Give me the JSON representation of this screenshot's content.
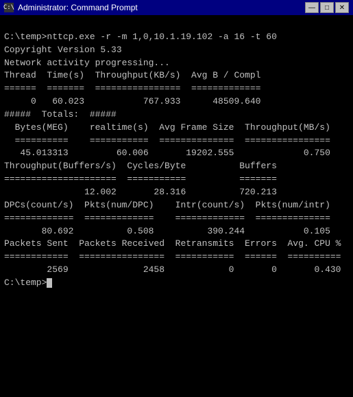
{
  "titleBar": {
    "icon": "C:\\",
    "title": "Administrator: Command Prompt",
    "minimize": "—",
    "maximize": "□",
    "close": "✕"
  },
  "terminal": {
    "lines": [
      "C:\\temp>nttcp.exe -r -m 1,0,10.1.19.102 -a 16 -t 60",
      "Copyright Version 5.33",
      "Network activity progressing...",
      "",
      "",
      "Thread  Time(s)  Throughput(KB/s)  Avg B / Compl",
      "======  =======  ================  =============",
      "     0   60.023           767.933      48509.640",
      "",
      "",
      "#####  Totals:  #####",
      "",
      "",
      "  Bytes(MEG)    realtime(s)  Avg Frame Size  Throughput(MB/s)",
      "  ==========    ===========  ==============  ================",
      "   45.013313         60.006       19202.555             0.750",
      "",
      "",
      "Throughput(Buffers/s)  Cycles/Byte          Buffers",
      "=====================  ===========          =======",
      "               12.002       28.316          720.213",
      "",
      "",
      "DPCs(count/s)  Pkts(num/DPC)    Intr(count/s)  Pkts(num/intr)",
      "=============  =============    =============  ==============",
      "       80.692          0.508          390.244           0.105",
      "",
      "",
      "Packets Sent  Packets Received  Retransmits  Errors  Avg. CPU %",
      "============  ================  ===========  ======  ==========",
      "        2569              2458            0       0       0.430",
      "",
      "C:\\temp>"
    ]
  }
}
